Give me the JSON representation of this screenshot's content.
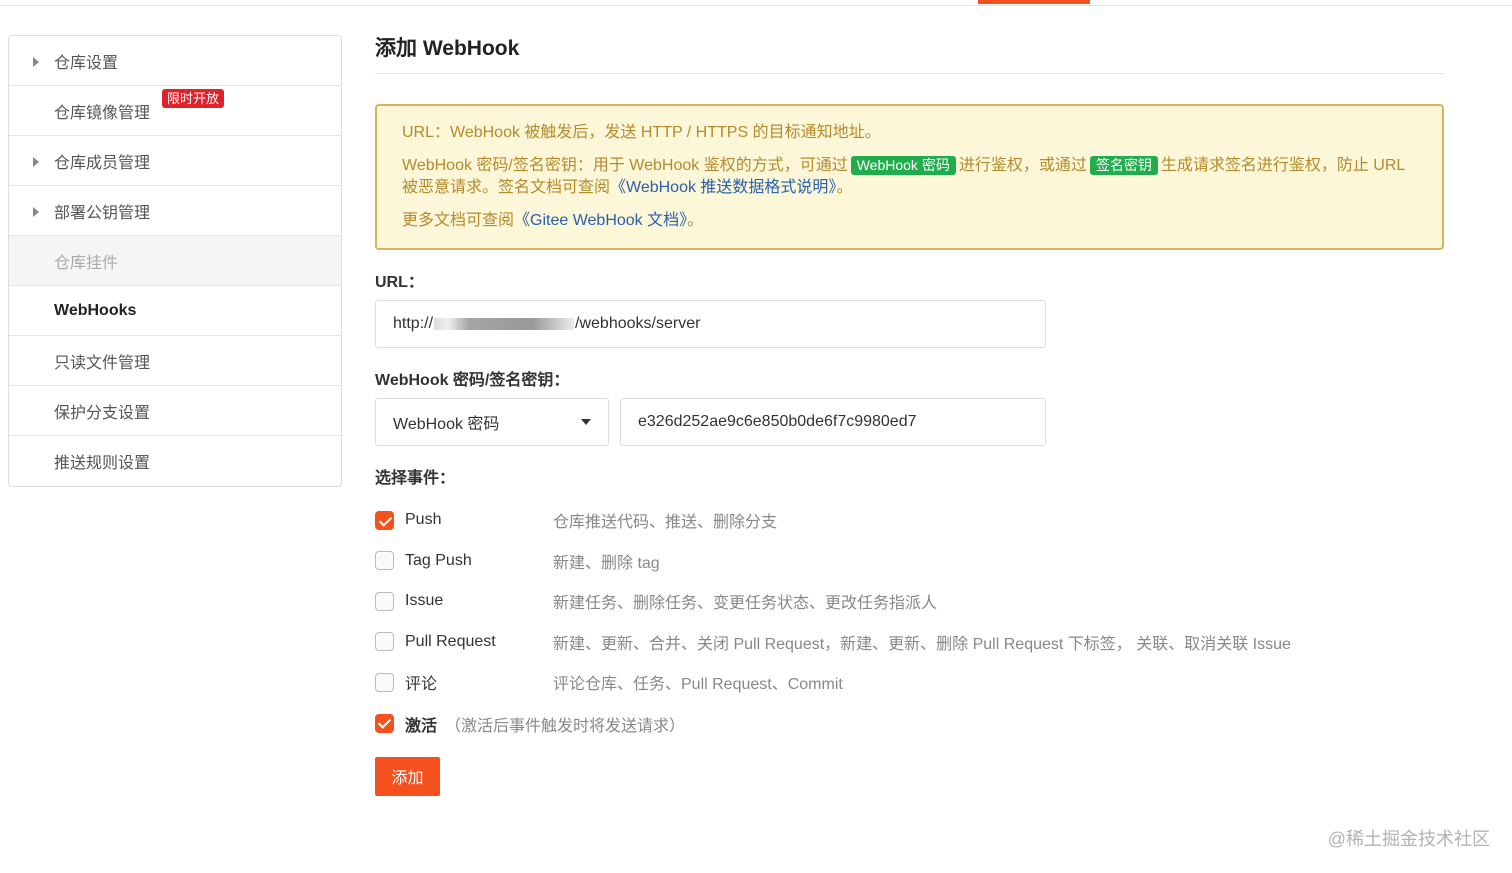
{
  "sidebar": {
    "items": [
      {
        "label": "仓库设置"
      },
      {
        "label": "仓库镜像管理",
        "badge": "限时开放"
      },
      {
        "label": "仓库成员管理"
      },
      {
        "label": "部署公钥管理"
      },
      {
        "label": "仓库挂件"
      },
      {
        "label": "WebHooks"
      },
      {
        "label": "只读文件管理"
      },
      {
        "label": "保护分支设置"
      },
      {
        "label": "推送规则设置"
      }
    ]
  },
  "main": {
    "title": "添加 WebHook",
    "notice": {
      "line1": "URL：WebHook 被触发后，发送 HTTP / HTTPS 的目标通知地址。",
      "line2_a": "WebHook 密码/签名密钥：用于 WebHook 鉴权的方式，可通过",
      "tag_password": "WebHook 密码",
      "line2_b": "进行鉴权，或通过",
      "tag_secret": "签名密钥",
      "line2_c": "生成请求签名进行鉴权，防止 URL 被恶意请求。签名文档可查阅",
      "link_format": "《WebHook 推送数据格式说明》",
      "line2_end": "。",
      "line3_a": "更多文档可查阅",
      "link_docs": "《Gitee WebHook 文档》",
      "line3_end": "。"
    },
    "url_label": "URL：",
    "url_prefix": "http://",
    "url_suffix": "/webhooks/server",
    "secret_label": "WebHook 密码/签名密钥：",
    "secret_type": "WebHook 密码",
    "secret_value": "e326d252ae9c6e850b0de6f7c9980ed7",
    "events_label": "选择事件：",
    "events": [
      {
        "name": "Push",
        "desc": "仓库推送代码、推送、删除分支",
        "checked": true
      },
      {
        "name": "Tag Push",
        "desc": "新建、删除 tag",
        "checked": false
      },
      {
        "name": "Issue",
        "desc": "新建任务、删除任务、变更任务状态、更改任务指派人",
        "checked": false
      },
      {
        "name": "Pull Request",
        "desc": "新建、更新、合并、关闭 Pull Request，新建、更新、删除 Pull Request 下标签，  关联、取消关联 Issue",
        "checked": false
      },
      {
        "name": "评论",
        "desc": "评论仓库、任务、Pull Request、Commit",
        "checked": false
      }
    ],
    "activate_label": "激活",
    "activate_hint": "（激活后事件触发时将发送请求）",
    "add_button": "添加"
  },
  "watermark": "@稀土掘金技术社区",
  "colors": {
    "accent": "#f4511e",
    "badge_red": "#e0232a",
    "tag_green": "#21ac4e",
    "notice_bg": "#fcf7d9",
    "notice_border": "#d9b55a",
    "link": "#2b5fa8"
  }
}
